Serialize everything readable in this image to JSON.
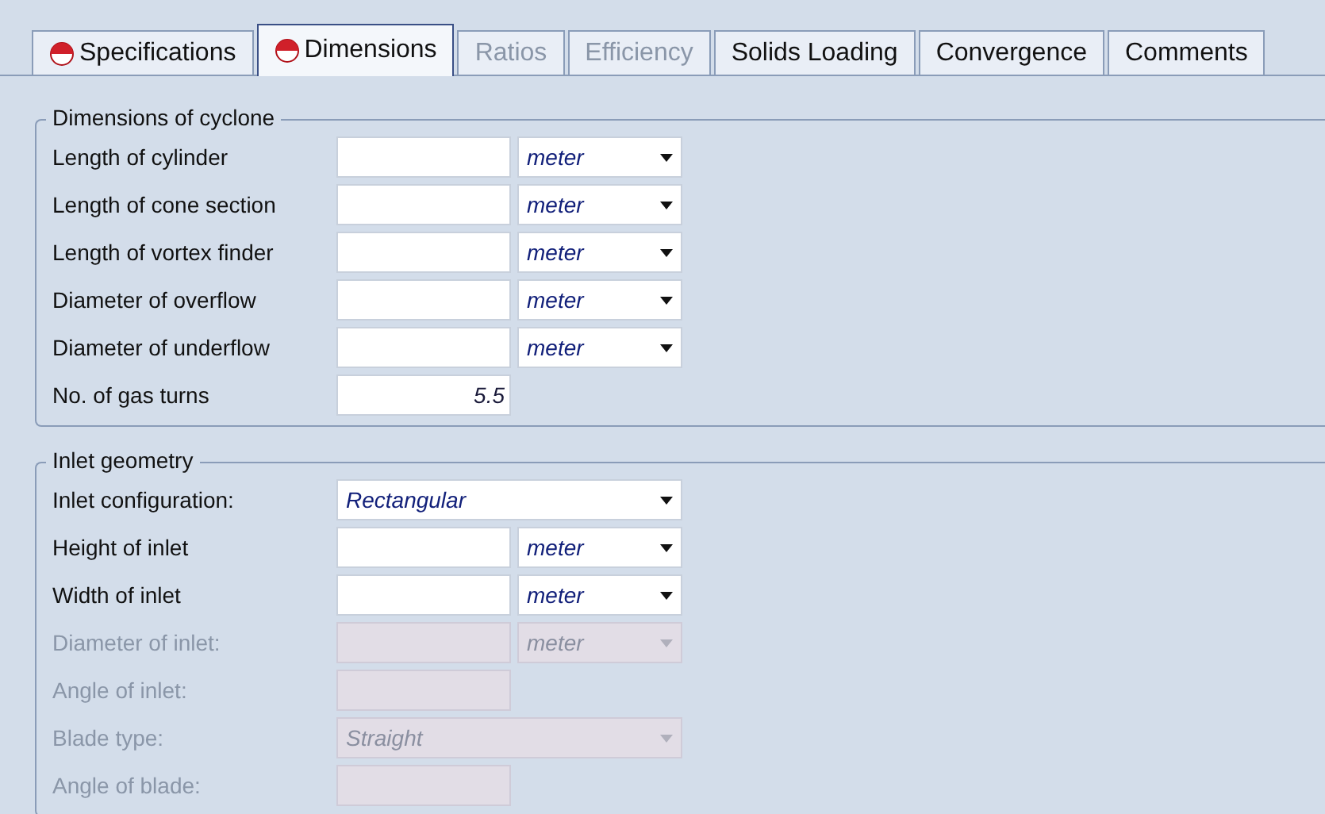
{
  "tabs": [
    {
      "label": "Specifications",
      "selected": false,
      "disabled": false,
      "incomplete": true
    },
    {
      "label": "Dimensions",
      "selected": true,
      "disabled": false,
      "incomplete": true
    },
    {
      "label": "Ratios",
      "selected": false,
      "disabled": true,
      "incomplete": false
    },
    {
      "label": "Efficiency",
      "selected": false,
      "disabled": true,
      "incomplete": false
    },
    {
      "label": "Solids Loading",
      "selected": false,
      "disabled": false,
      "incomplete": false
    },
    {
      "label": "Convergence",
      "selected": false,
      "disabled": false,
      "incomplete": false
    },
    {
      "label": "Comments",
      "selected": false,
      "disabled": false,
      "incomplete": false
    }
  ],
  "groups": [
    {
      "title": "Dimensions of cyclone",
      "rows": [
        {
          "kind": "measure",
          "label": "Length of cylinder",
          "unit": "meter",
          "disabled": false
        },
        {
          "kind": "measure",
          "label": "Length of cone section",
          "unit": "meter",
          "disabled": false
        },
        {
          "kind": "measure",
          "label": "Length of vortex finder",
          "unit": "meter",
          "disabled": false
        },
        {
          "kind": "measure",
          "label": "Diameter of overflow",
          "unit": "meter",
          "disabled": false
        },
        {
          "kind": "measure",
          "label": "Diameter of underflow",
          "unit": "meter",
          "disabled": false
        },
        {
          "kind": "number",
          "label": "No. of gas turns",
          "value": "5.5",
          "disabled": false
        }
      ]
    },
    {
      "title": "Inlet geometry",
      "rows": [
        {
          "kind": "select",
          "label": "Inlet configuration:",
          "value": "Rectangular",
          "disabled": false
        },
        {
          "kind": "measure",
          "label": "Height of inlet",
          "unit": "meter",
          "disabled": false
        },
        {
          "kind": "measure",
          "label": "Width of inlet",
          "unit": "meter",
          "disabled": false
        },
        {
          "kind": "measure",
          "label": "Diameter of inlet:",
          "unit": "meter",
          "disabled": true
        },
        {
          "kind": "input",
          "label": "Angle of inlet:",
          "disabled": true
        },
        {
          "kind": "select",
          "label": "Blade type:",
          "value": "Straight",
          "disabled": true
        },
        {
          "kind": "input",
          "label": "Angle of blade:",
          "disabled": true
        }
      ]
    }
  ]
}
